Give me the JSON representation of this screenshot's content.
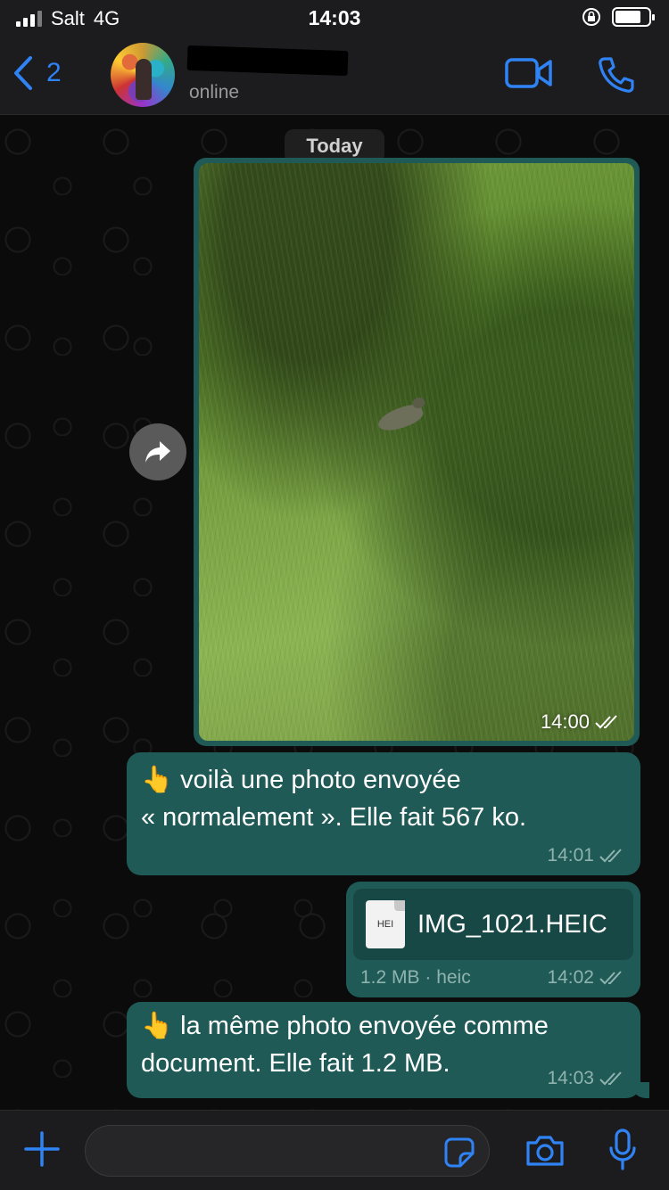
{
  "status_bar": {
    "carrier": "Salt",
    "network": "4G",
    "time": "14:03"
  },
  "header": {
    "back_count": "2",
    "status": "online"
  },
  "chat": {
    "date_label": "Today",
    "photo_message": {
      "time": "14:00"
    },
    "messages": [
      {
        "emoji": "👆",
        "line1": "voilà une photo envoyée",
        "line2": "« normalement ». Elle fait 567 ko.",
        "time": "14:01"
      },
      {
        "emoji": "👆",
        "line1": "la même photo envoyée comme",
        "line2": "document. Elle fait 1.2 MB.",
        "time": "14:03"
      }
    ],
    "document_message": {
      "icon_label": "HEI",
      "file_name": "IMG_1021.HEIC",
      "size_type": "1.2 MB · heic",
      "time": "14:02"
    }
  },
  "colors": {
    "accent": "#2f83f5",
    "bubble": "#1f5a57",
    "header_bg": "#1c1c1e"
  },
  "icons": [
    "back-chevron-icon",
    "video-call-icon",
    "phone-icon",
    "forward-icon",
    "read-receipt-icon",
    "plus-icon",
    "sticker-icon",
    "camera-icon",
    "microphone-icon"
  ]
}
